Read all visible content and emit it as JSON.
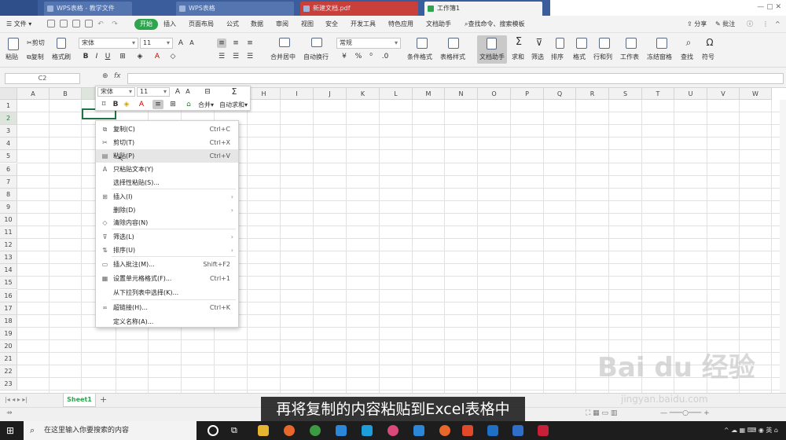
{
  "tabbar": {
    "tabs": [
      {
        "label": "WPS表格 - 教学文件"
      },
      {
        "label": "WPS表格"
      },
      {
        "label": "新建文档.pdf"
      },
      {
        "label": "工作簿1"
      }
    ]
  },
  "menubar": {
    "file": "文件",
    "items": [
      "开始",
      "插入",
      "页面布局",
      "公式",
      "数据",
      "审阅",
      "视图",
      "安全",
      "开发工具",
      "特色应用",
      "文档助手"
    ],
    "search": "查找命令、搜索模板",
    "share": "分享",
    "comment": "批注"
  },
  "ribbon": {
    "paste": "粘贴",
    "cut": "剪切",
    "copy": "复制",
    "format_painter": "格式刷",
    "font_name": "宋体",
    "font_size": "11",
    "number_format": "常规",
    "buttons": [
      "合并居中",
      "自动换行",
      "条件格式",
      "表格样式",
      "文档助手",
      "求和",
      "筛选",
      "排序",
      "格式",
      "行和列",
      "工作表",
      "冻结窗格",
      "查找",
      "符号"
    ]
  },
  "formula_bar": {
    "cell_ref": "C2",
    "fx": "fx"
  },
  "grid": {
    "columns": [
      "A",
      "B",
      "C",
      "D",
      "E",
      "F",
      "G",
      "H",
      "I",
      "J",
      "K",
      "L",
      "M",
      "N",
      "O",
      "P",
      "Q",
      "R",
      "S",
      "T",
      "U",
      "V",
      "W"
    ],
    "rows": [
      "1",
      "2",
      "3",
      "4",
      "5",
      "6",
      "7",
      "8",
      "9",
      "10",
      "11",
      "12",
      "13",
      "14",
      "15",
      "16",
      "17",
      "18",
      "19",
      "20",
      "21",
      "22",
      "23"
    ]
  },
  "mini_toolbar": {
    "font_name": "宋体",
    "font_size": "11",
    "bold": "B",
    "font_color": "A",
    "merge": "合并",
    "autosum": "自动求和"
  },
  "context_menu": {
    "items": [
      {
        "label": "复制(C)",
        "shortcut": "Ctrl+C",
        "icon": "copy-icon"
      },
      {
        "label": "剪切(T)",
        "shortcut": "Ctrl+X",
        "icon": "scissors-icon"
      },
      {
        "label": "粘贴(P)",
        "shortcut": "Ctrl+V",
        "icon": "paste-icon"
      },
      {
        "label": "只粘贴文本(Y)",
        "shortcut": "",
        "icon": "paste-text-icon"
      },
      {
        "label": "选择性粘贴(S)...",
        "shortcut": "",
        "icon": ""
      },
      {
        "label": "插入(I)",
        "shortcut": "",
        "icon": "insert-icon"
      },
      {
        "label": "删除(D)",
        "shortcut": "",
        "icon": ""
      },
      {
        "label": "清除内容(N)",
        "shortcut": "",
        "icon": "eraser-icon"
      },
      {
        "label": "筛选(L)",
        "shortcut": "",
        "icon": "filter-icon"
      },
      {
        "label": "排序(U)",
        "shortcut": "",
        "icon": "sort-icon"
      },
      {
        "label": "插入批注(M)...",
        "shortcut": "Shift+F2",
        "icon": "comment-icon"
      },
      {
        "label": "设置单元格格式(F)...",
        "shortcut": "Ctrl+1",
        "icon": "format-cells-icon"
      },
      {
        "label": "从下拉列表中选择(K)...",
        "shortcut": "",
        "icon": ""
      },
      {
        "label": "超链接(H)...",
        "shortcut": "Ctrl+K",
        "icon": "link-icon"
      },
      {
        "label": "定义名称(A)...",
        "shortcut": "",
        "icon": ""
      }
    ]
  },
  "sheets": {
    "tabs": [
      "Sheet1"
    ],
    "add": "+"
  },
  "subtitle": "再将复制的内容粘贴到Excel表格中",
  "watermark": {
    "brand": "Bai du 经验",
    "url": "jingyan.baidu.com"
  },
  "taskbar": {
    "search_placeholder": "在这里输入你要搜索的内容"
  },
  "colors": {
    "accent": "#2ea44f",
    "titlebar": "#3b5d9c",
    "selection": "#217346"
  }
}
